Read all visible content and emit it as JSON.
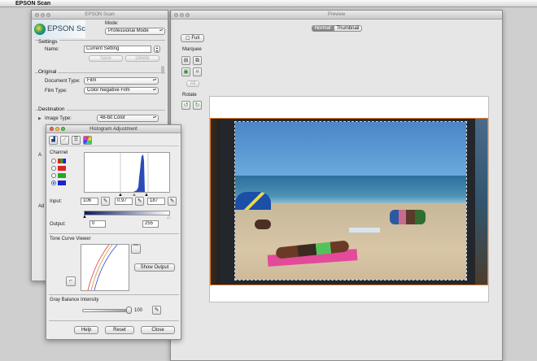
{
  "menubar": {
    "app_name": "EPSON Scan"
  },
  "main_window": {
    "title": "EPSON Scan",
    "logo_text": "EPSON Scan",
    "mode_label": "Mode:",
    "mode_value": "Professional Mode",
    "settings_heading": "Settings",
    "name_label": "Name:",
    "name_value": "Current Setting",
    "save_label": "Save",
    "delete_label": "Delete",
    "original_heading": "Original",
    "document_type_label": "Document Type:",
    "document_type_value": "Film",
    "film_type_label": "Film Type:",
    "film_type_value": "Color Negative Film",
    "destination_heading": "Destination",
    "image_type_label": "Image Type:",
    "image_type_value": "48-bit Color",
    "partial_a": "A",
    "partial_b": "Ad"
  },
  "preview_window": {
    "title": "Preview",
    "tab_normal": "Normal",
    "tab_thumbnail": "Thumbnail",
    "full_label": "Full",
    "marquee_label": "Marquee",
    "all_label": "All",
    "rotate_label": "Rotate"
  },
  "histogram_window": {
    "title": "Histogram Adjustment",
    "channel_label": "Channel",
    "input_label": "Input:",
    "input_black": "106",
    "input_gamma": "0.97",
    "input_white": "187",
    "output_label": "Output:",
    "output_black": "0",
    "output_white": "255",
    "tone_curve_label": "Tone Curve Viewer",
    "show_output_label": "Show Output",
    "gray_balance_label": "Gray Balance Intensity",
    "gray_balance_value": "100",
    "help_label": "Help",
    "reset_label": "Reset",
    "close_label": "Close"
  },
  "icons": [
    "apple-icon",
    "close-dot-icon",
    "minimize-dot-icon",
    "zoom-dot-icon",
    "arrow-icon",
    "eyedropper-icon",
    "marquee-icon",
    "rotate-left-icon",
    "rotate-right-icon",
    "histogram-icon",
    "tone-curve-icon",
    "color-wheel-icon",
    "curve-reset-icon"
  ]
}
